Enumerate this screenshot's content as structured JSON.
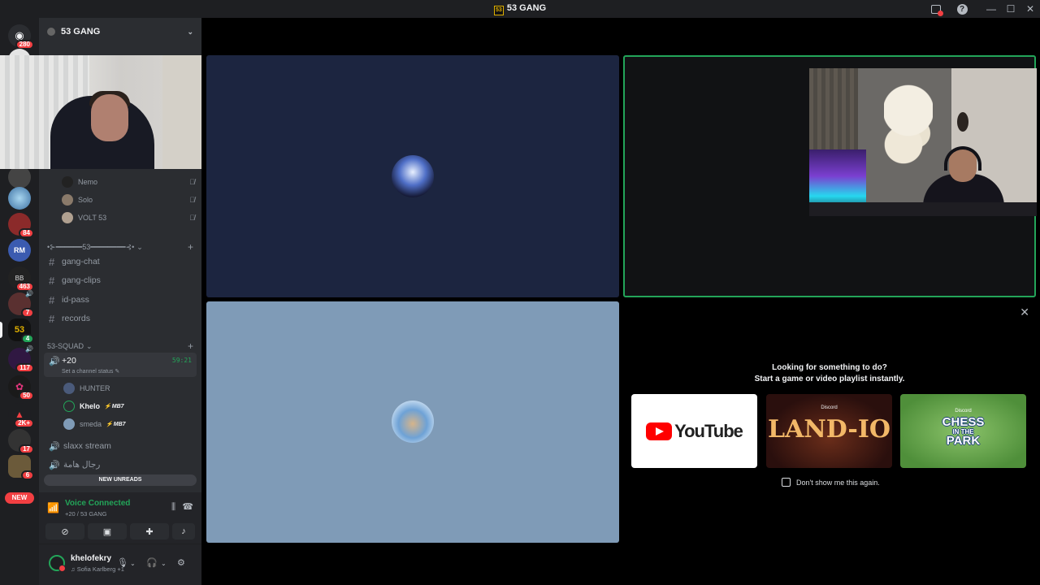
{
  "window": {
    "title": "53 GANG",
    "app_icon": "53"
  },
  "rail": {
    "servers": [
      {
        "name": "dm",
        "badge": "280"
      },
      {
        "name": "s1",
        "badge": ""
      },
      {
        "name": "s2",
        "badge": ""
      },
      {
        "name": "s3",
        "badge": "84"
      },
      {
        "name": "s4",
        "badge": ""
      },
      {
        "name": "s5",
        "badge": "463"
      },
      {
        "name": "s6",
        "badge": "7"
      },
      {
        "name": "s7",
        "badge": "4"
      },
      {
        "name": "s8",
        "badge": "117"
      },
      {
        "name": "s9",
        "badge": "50"
      },
      {
        "name": "s10",
        "badge": "2K+"
      },
      {
        "name": "s11",
        "badge": "17"
      },
      {
        "name": "s12",
        "badge": "6"
      }
    ],
    "new_label": "NEW"
  },
  "guild": {
    "name": "53 GANG"
  },
  "members_top": [
    {
      "name": "Nemo"
    },
    {
      "name": "Solo"
    },
    {
      "name": "VOLT 53"
    }
  ],
  "category1": "•⊱━━━━━━53━━━━━━━━⊰•",
  "channels": [
    "gang-chat",
    "gang-clips",
    "id-pass",
    "records"
  ],
  "category2": "53-SQUAD",
  "active_voice": {
    "name": "+20",
    "timer": "59:21",
    "status": "Set a channel status"
  },
  "voice_members": [
    {
      "name": "HUNTER",
      "tag": ""
    },
    {
      "name": "Khelo",
      "tag": "MB7"
    },
    {
      "name": "smeda",
      "tag": "MB7"
    }
  ],
  "voice_channels": [
    "slaxx stream",
    "رجال هامة"
  ],
  "new_unreads": "NEW UNREADS",
  "voice_panel": {
    "status": "Voice Connected",
    "location": "+20 / 53 GANG"
  },
  "user": {
    "name": "khelofekry",
    "status": "Sofia Karlberg +1"
  },
  "activity": {
    "heading1": "Looking for something to do?",
    "heading2": "Start a game or video playlist instantly.",
    "youtube": "YouTube",
    "land_brand": "Discord",
    "land_title": "LAND-IO",
    "chess_brand": "Discord",
    "chess_title_1": "CHESS",
    "chess_title_2": "IN THE",
    "chess_title_3": "PARK",
    "dont_show": "Don't show me this again."
  },
  "colors": {
    "green": "#23a559",
    "red": "#f23f42",
    "bg_sidebar": "#2b2d31",
    "bg_rail": "#1e1f22"
  }
}
